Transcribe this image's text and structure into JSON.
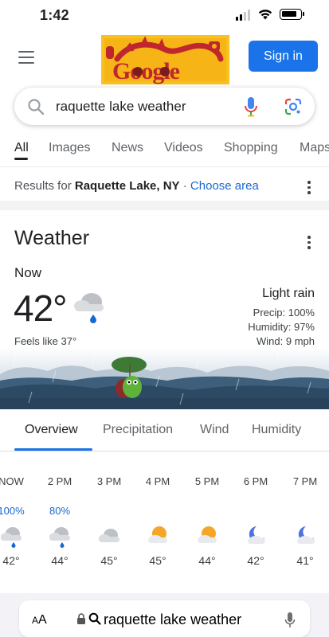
{
  "status_bar": {
    "time": "1:42"
  },
  "header": {
    "sign_in_label": "Sign in",
    "doodle_icon": "google-doodle-dragon"
  },
  "search": {
    "query": "raquette lake weather"
  },
  "tabs": [
    {
      "label": "All",
      "active": true
    },
    {
      "label": "Images"
    },
    {
      "label": "News"
    },
    {
      "label": "Videos"
    },
    {
      "label": "Shopping"
    },
    {
      "label": "Maps"
    }
  ],
  "results_for": {
    "prefix": "Results for ",
    "location": "Raquette Lake, NY",
    "separator": " · ",
    "link": "Choose area"
  },
  "weather": {
    "title": "Weather",
    "now_label": "Now",
    "temperature": "42",
    "degree": "°",
    "feels_like": "Feels like 37°",
    "condition": "Light rain",
    "precip": "Precip: 100%",
    "humidity": "Humidity: 97%",
    "wind": "Wind: 9 mph",
    "current_icon": "rain-cloud-icon"
  },
  "overview_tabs": [
    {
      "label": "Overview",
      "active": true
    },
    {
      "label": "Precipitation"
    },
    {
      "label": "Wind"
    },
    {
      "label": "Humidity"
    }
  ],
  "hourly": [
    {
      "time": "NOW",
      "precip": "100%",
      "icon": "rain",
      "temp": "42°"
    },
    {
      "time": "2 PM",
      "precip": "80%",
      "icon": "rain",
      "temp": "44°"
    },
    {
      "time": "3 PM",
      "precip": "",
      "icon": "cloud",
      "temp": "45°"
    },
    {
      "time": "4 PM",
      "precip": "",
      "icon": "sun-cloud",
      "temp": "45°"
    },
    {
      "time": "5 PM",
      "precip": "",
      "icon": "sun-cloud",
      "temp": "44°"
    },
    {
      "time": "6 PM",
      "precip": "",
      "icon": "moon-cloud",
      "temp": "42°"
    },
    {
      "time": "7 PM",
      "precip": "",
      "icon": "moon-cloud",
      "temp": "41°"
    }
  ],
  "browser": {
    "text_size_label_small": "A",
    "text_size_label_large": "A",
    "url": "raquette lake weather"
  },
  "colors": {
    "google_blue": "#1a73e8",
    "link_blue": "#1967d2",
    "rain_drop": "#1967d2",
    "sun": "#f4a62a"
  }
}
